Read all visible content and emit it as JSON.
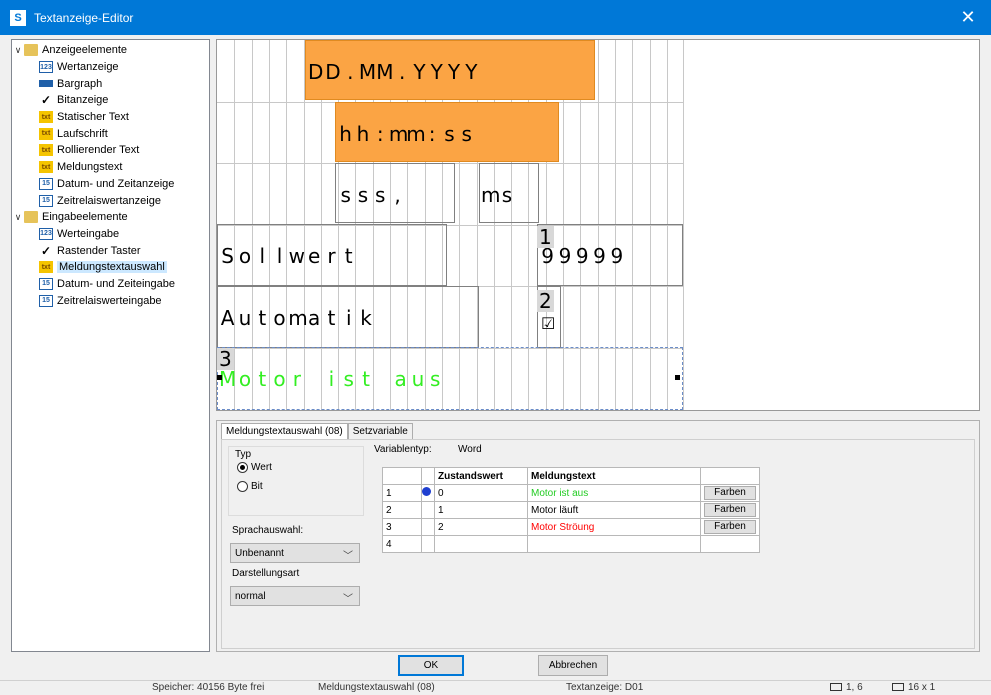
{
  "window": {
    "title": "Textanzeige-Editor",
    "app_icon_glyph": "S",
    "close_glyph": "✕"
  },
  "tree": {
    "groups": [
      {
        "label": "Anzeigeelemente",
        "icon": "folder-icon",
        "items": [
          {
            "label": "Wertanzeige",
            "icon": "number-display-icon"
          },
          {
            "label": "Bargraph",
            "icon": "bargraph-icon"
          },
          {
            "label": "Bitanzeige",
            "icon": "checkmark-icon"
          },
          {
            "label": "Statischer Text",
            "icon": "static-text-icon"
          },
          {
            "label": "Laufschrift",
            "icon": "scrolling-text-icon"
          },
          {
            "label": "Rollierender Text",
            "icon": "rolling-text-icon"
          },
          {
            "label": "Meldungstext",
            "icon": "message-text-icon"
          },
          {
            "label": "Datum- und Zeitanzeige",
            "icon": "calendar-icon"
          },
          {
            "label": "Zeitrelaiswertanzeige",
            "icon": "timer-relay-icon"
          }
        ]
      },
      {
        "label": "Eingabeelemente",
        "icon": "folder-icon",
        "items": [
          {
            "label": "Werteingabe",
            "icon": "number-input-icon"
          },
          {
            "label": "Rastender Taster",
            "icon": "checkmark-icon"
          },
          {
            "label": "Meldungstextauswahl",
            "icon": "message-select-icon",
            "selected": true
          },
          {
            "label": "Datum- und Zeiteingabe",
            "icon": "calendar-icon"
          },
          {
            "label": "Zeitrelaiswerteingabe",
            "icon": "timer-relay-icon"
          }
        ]
      }
    ]
  },
  "canvas": {
    "row1": [
      "D",
      "D",
      ".",
      "M",
      "M",
      ".",
      "Y",
      "Y",
      "Y",
      "Y"
    ],
    "row2": [
      "h",
      "h",
      ":",
      "m",
      "m",
      ":",
      "s",
      "s"
    ],
    "row3a": [
      "s",
      "s",
      "s",
      ","
    ],
    "row3b": [
      "m",
      "s"
    ],
    "row4a": [
      "S",
      "o",
      "l",
      "l",
      "w",
      "e",
      "r",
      "t"
    ],
    "row4_tag": "1",
    "row4b": [
      "9",
      "9",
      "9",
      "9",
      "9"
    ],
    "row5": [
      "A",
      "u",
      "t",
      "o",
      "m",
      "a",
      "t",
      "i",
      "k"
    ],
    "row5_tag": "2",
    "row5_check": "☑",
    "row6_tag": "3",
    "row6": [
      "M",
      "o",
      "t",
      "o",
      "r",
      " ",
      "i",
      "s",
      "t",
      " ",
      "a",
      "u",
      "s"
    ],
    "colors": {
      "orange": "#fba444",
      "green": "#33ee22"
    }
  },
  "tabs": [
    {
      "label": "Meldungstextauswahl (08)",
      "active": true
    },
    {
      "label": "Setzvariable",
      "active": false
    }
  ],
  "form": {
    "typ_label": "Typ",
    "radio_wert": "Wert",
    "radio_bit": "Bit",
    "selected_radio": "Wert",
    "sprachauswahl_label": "Sprachauswahl:",
    "sprachauswahl_value": "Unbenannt",
    "darstellung_label": "Darstellungsart",
    "darstellung_value": "normal",
    "variablentyp_label": "Variablentyp:",
    "variablentyp_value": "Word"
  },
  "table": {
    "headers": [
      "Zustandswert",
      "Meldungstext"
    ],
    "rows": [
      {
        "n": "1",
        "wert": "0",
        "text": "Motor ist aus",
        "color": "#22cc22",
        "button": "Farben",
        "marker": true
      },
      {
        "n": "2",
        "wert": "1",
        "text": "Motor läuft",
        "color": "#000000",
        "button": "Farben",
        "marker": false
      },
      {
        "n": "3",
        "wert": "2",
        "text": "Motor Ströung",
        "color": "#ff0000",
        "button": "Farben",
        "marker": false
      },
      {
        "n": "4",
        "wert": "",
        "text": "",
        "color": "#000000",
        "button": "",
        "marker": false
      }
    ]
  },
  "buttons": {
    "ok": "OK",
    "cancel": "Abbrechen"
  },
  "status": {
    "memory": "Speicher: 40156 Byte frei",
    "element": "Meldungstextauswahl (08)",
    "display": "Textanzeige: D01",
    "position": "1, 6",
    "size": "16 x 1"
  }
}
